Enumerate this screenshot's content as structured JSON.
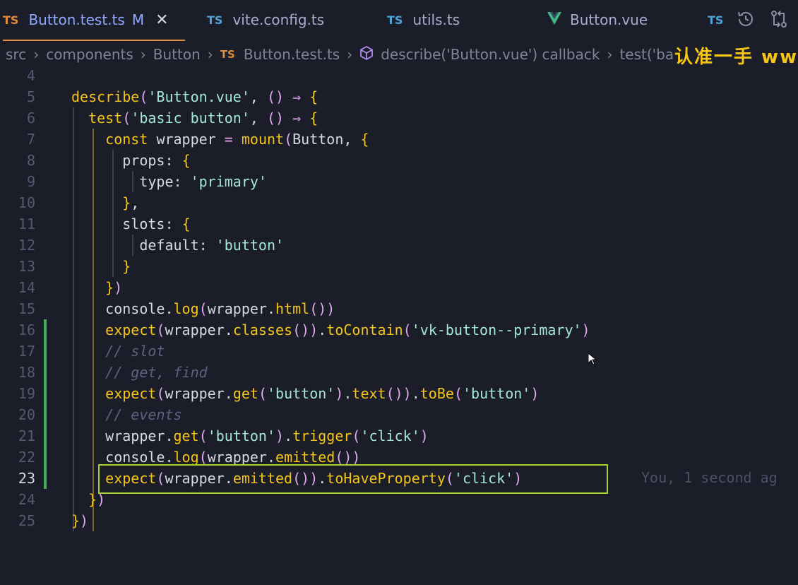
{
  "tabs": [
    {
      "lang": "TS",
      "label": "Button.test.ts",
      "modified": "M",
      "close": "✕",
      "active": true
    },
    {
      "lang": "TS",
      "label": "vite.config.ts"
    },
    {
      "lang": "TS",
      "label": "utils.ts"
    },
    {
      "lang": "vue",
      "label": "Button.vue"
    },
    {
      "lang": "TS",
      "label": ""
    }
  ],
  "breadcrumb": {
    "items": [
      "src",
      "components",
      "Button",
      "Button.test.ts",
      "describe('Button.vue') callback",
      "test('ba"
    ],
    "ts_badge": "TS"
  },
  "watermark": "认准一手 www.",
  "blame": "You, 1 second ag",
  "colors": {
    "background": "#1b1e28",
    "accent": "#8fa9ff",
    "highlight": "#a6d42c",
    "git_added": "#3fae5f"
  },
  "icons": {
    "history": "history-icon",
    "compare": "git-compare-icon",
    "cube": "symbol-method-icon",
    "vue": "vue-logo-icon"
  },
  "code": {
    "line_numbers": [
      "4",
      "5",
      "6",
      "7",
      "8",
      "9",
      "10",
      "11",
      "12",
      "13",
      "14",
      "15",
      "16",
      "17",
      "18",
      "19",
      "20",
      "21",
      "22",
      "23",
      "24",
      "25"
    ],
    "lines": [
      "",
      "describe('Button.vue', () ⇒ {",
      "  test('basic button', () ⇒ {",
      "    const wrapper = mount(Button, {",
      "      props: {",
      "        type: 'primary'",
      "      },",
      "      slots: {",
      "        default: 'button'",
      "      }",
      "    })",
      "    console.log(wrapper.html())",
      "    expect(wrapper.classes()).toContain('vk-button--primary')",
      "    // slot",
      "    // get, find",
      "    expect(wrapper.get('button').text()).toBe('button')",
      "    // events",
      "    wrapper.get('button').trigger('click')",
      "    console.log(wrapper.emitted())",
      "    expect(wrapper.emitted()).toHaveProperty('click')",
      "  })",
      "})"
    ]
  }
}
